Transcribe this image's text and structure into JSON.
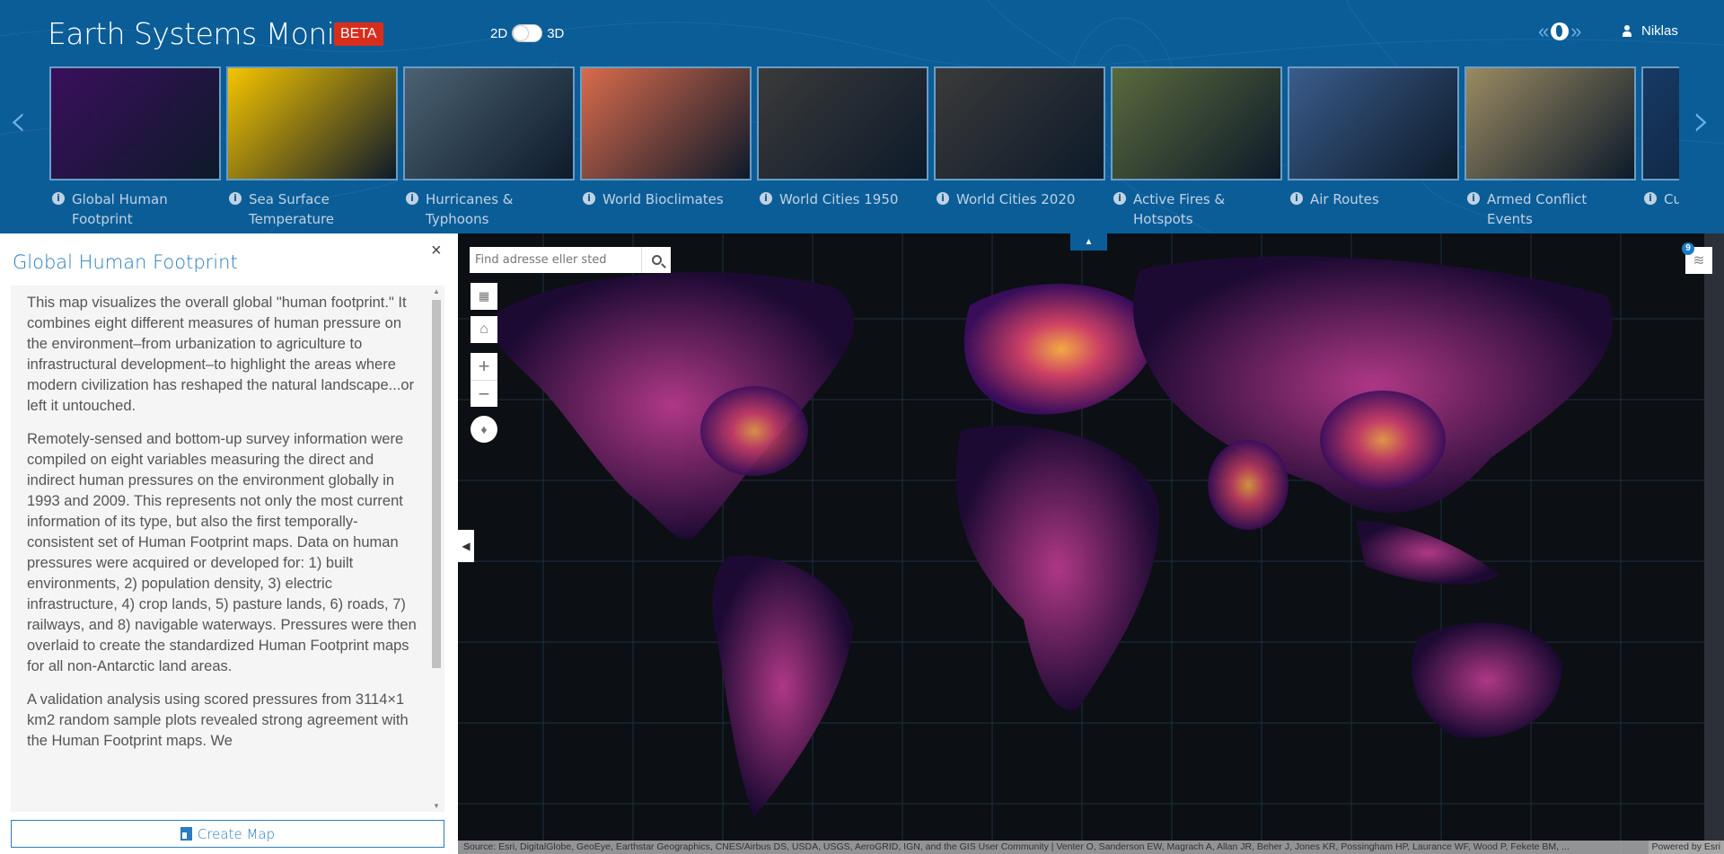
{
  "header": {
    "title": "Earth Systems Monitor",
    "badge": "BETA",
    "toggle": {
      "left": "2D",
      "right": "3D",
      "state": "2D"
    },
    "user": "Niklas",
    "nav_prev": "«",
    "nav_next": "»",
    "brand_color": "#0b5d98",
    "badge_color": "#d92d1c"
  },
  "carousel": {
    "prev": "‹",
    "next": "›",
    "items": [
      {
        "label": "Global Human Footprint",
        "theme": "#3a0f5c"
      },
      {
        "label": "Sea Surface Temperature",
        "theme": "#f5c400"
      },
      {
        "label": "Hurricanes & Typhoons",
        "theme": "#4b6272"
      },
      {
        "label": "World Bioclimates",
        "theme": "#d96b4c"
      },
      {
        "label": "World Cities 1950",
        "theme": "#3a3a3a"
      },
      {
        "label": "World Cities 2020",
        "theme": "#3a3a3a"
      },
      {
        "label": "Active Fires & Hotspots",
        "theme": "#5a6a3c"
      },
      {
        "label": "Air Routes",
        "theme": "#3a5c8c"
      },
      {
        "label": "Armed Conflict Events",
        "theme": "#9a8a62"
      },
      {
        "label": "Current Weather",
        "theme": "#163a66"
      }
    ]
  },
  "panel": {
    "title": "Global Human Footprint",
    "close": "×",
    "paragraphs": [
      "This map visualizes the overall global \"human footprint.\" It combines eight different measures of human pressure on the environment–from urbanization to agriculture to infrastructural development–to highlight the areas where modern civilization has reshaped the natural landscape...or left it untouched.",
      "Remotely-sensed and bottom-up survey information were compiled on eight variables measuring the direct and indirect human pressures on the environment globally in 1993 and 2009. This represents not only the most current information of its type, but also the first temporally-consistent set of Human Footprint maps. Data on human pressures were acquired or developed for: 1) built environments, 2) population density, 3) electric infrastructure, 4) crop lands, 5) pasture lands, 6) roads, 7) railways, and 8) navigable waterways. Pressures were then overlaid to create the standardized Human Footprint maps for all non-Antarctic land areas.",
      "A validation analysis using scored pressures from 3114×1 km2 random sample plots revealed strong agreement with the Human Footprint maps. We"
    ],
    "create_map": "Create Map"
  },
  "map": {
    "search_placeholder": "Find adresse eller sted",
    "layers_count": "9",
    "attribution": "Source: Esri, DigitalGlobe, GeoEye, Earthstar Geographics, CNES/Airbus DS, USDA, USGS, AeroGRID, IGN, and the GIS User Community | Venter O, Sanderson EW, Magrach A, Allan JR, Beher J, Jones KR, Possingham HP, Laurance WF, Wood P, Fekete BM, ...",
    "powered_by": "Powered by Esri"
  }
}
